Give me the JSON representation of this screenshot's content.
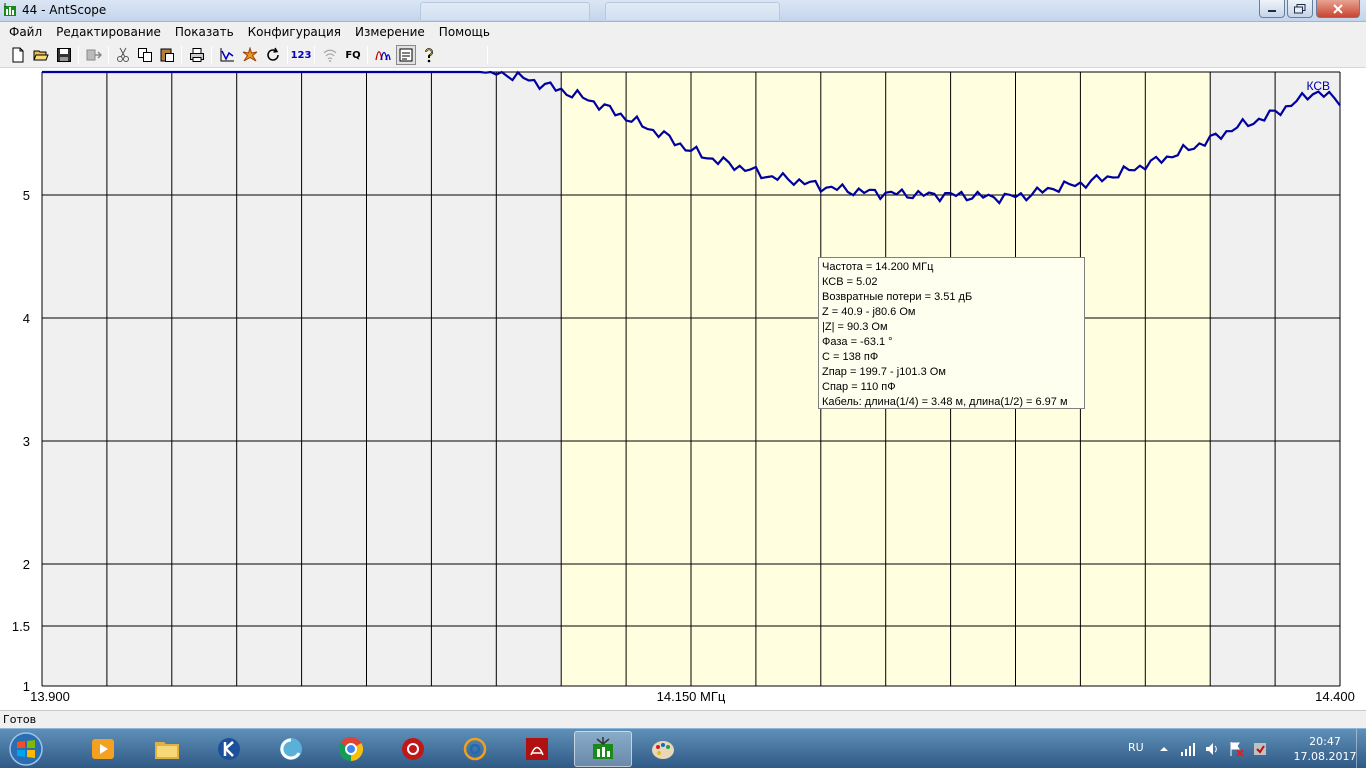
{
  "window": {
    "title": "44 - AntScope"
  },
  "menu": {
    "items": [
      "Файл",
      "Редактирование",
      "Показать",
      "Конфигурация",
      "Измерение",
      "Помощь"
    ]
  },
  "toolbar": {
    "buttons": [
      "new-file",
      "open-folder",
      "save",
      "export",
      "cut",
      "copy",
      "paste",
      "print",
      "graph",
      "star",
      "refresh",
      "numbers",
      "wireless",
      "fq",
      "curves",
      "notes",
      "help"
    ],
    "numbers_label": "123",
    "fq_label": "FQ"
  },
  "chart_data": {
    "type": "line",
    "title": "",
    "series": [
      {
        "name": "КСВ"
      }
    ],
    "x_unit_label": "14.150 МГц",
    "x_min_label": "13.900",
    "x_max_label": "14.400",
    "xlim": [
      13.9,
      14.4
    ],
    "y_tick_labels": [
      "1",
      "1.5",
      "2",
      "3",
      "4",
      "5"
    ],
    "y_ticks": [
      1,
      1.5,
      2,
      3,
      4,
      5
    ],
    "ylim": [
      1,
      6
    ],
    "shaded_band": [
      14.1,
      14.35
    ],
    "grid": true,
    "points": [
      [
        13.9,
        6.0
      ],
      [
        14.0,
        6.0
      ],
      [
        14.07,
        6.0
      ],
      [
        14.08,
        5.98
      ],
      [
        14.09,
        5.92
      ],
      [
        14.1,
        5.85
      ],
      [
        14.11,
        5.78
      ],
      [
        14.12,
        5.68
      ],
      [
        14.13,
        5.58
      ],
      [
        14.14,
        5.48
      ],
      [
        14.15,
        5.36
      ],
      [
        14.16,
        5.28
      ],
      [
        14.17,
        5.22
      ],
      [
        14.18,
        5.15
      ],
      [
        14.19,
        5.12
      ],
      [
        14.2,
        5.07
      ],
      [
        14.21,
        5.04
      ],
      [
        14.22,
        5.02
      ],
      [
        14.23,
        5.01
      ],
      [
        14.24,
        5.0
      ],
      [
        14.25,
        5.0
      ],
      [
        14.26,
        4.99
      ],
      [
        14.27,
        4.98
      ],
      [
        14.28,
        5.0
      ],
      [
        14.29,
        5.06
      ],
      [
        14.3,
        5.09
      ],
      [
        14.31,
        5.14
      ],
      [
        14.32,
        5.21
      ],
      [
        14.33,
        5.28
      ],
      [
        14.34,
        5.36
      ],
      [
        14.35,
        5.45
      ],
      [
        14.36,
        5.55
      ],
      [
        14.37,
        5.62
      ],
      [
        14.38,
        5.72
      ],
      [
        14.39,
        5.84
      ],
      [
        14.4,
        5.77
      ]
    ]
  },
  "info_box": {
    "lines": [
      "Частота = 14.200 МГц",
      "КСВ = 5.02",
      "Возвратные потери = 3.51 дБ",
      "Z = 40.9 - j80.6 Ом",
      "|Z| = 90.3 Ом",
      "Фаза = -63.1 °",
      "С = 138 пФ",
      "Zпар = 199.7 - j101.3 Ом",
      "Спар = 110 пФ",
      "Кабель: длина(1/4) = 3.48 м, длина(1/2) = 6.97 м"
    ]
  },
  "status": {
    "text": "Готов"
  },
  "taskbar": {
    "lang": "RU",
    "time": "20:47",
    "date": "17.08.2017"
  },
  "colors": {
    "trace": "#0000a0",
    "band": "#ffffe0",
    "out_of_band": "#f0f0f0",
    "grid": "#000000"
  }
}
